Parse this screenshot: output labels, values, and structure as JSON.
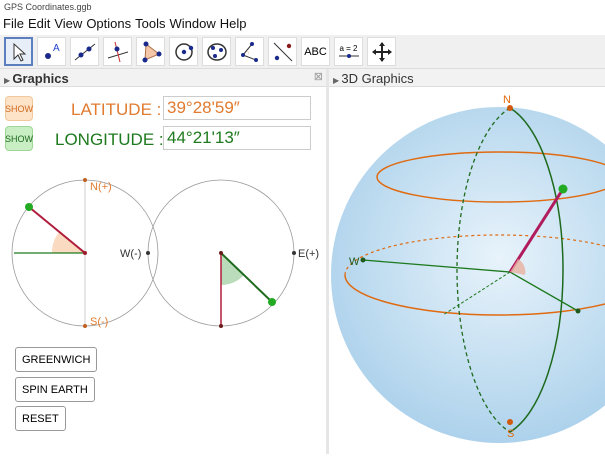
{
  "window": {
    "title": "GPS Coordinates.ggb"
  },
  "menu": [
    "File",
    "Edit",
    "View",
    "Options",
    "Tools",
    "Window",
    "Help"
  ],
  "toolbar": {
    "tools": [
      "move",
      "point",
      "line",
      "perpendicular-line",
      "polygon",
      "circle-center-point",
      "conic-five-points",
      "angle",
      "reflect",
      "text",
      "slider",
      "move-graphics-view"
    ],
    "text_tool_label": "ABC",
    "slider_label": "a = 2"
  },
  "panels": {
    "graphics": "Graphics",
    "graphics3d": "3D Graphics"
  },
  "latitude": {
    "show_label": "SHOW",
    "label": "LATITUDE :",
    "value": "39°28'59″",
    "color": "#e07b30"
  },
  "longitude": {
    "show_label": "SHOW",
    "label": "LONGITUDE :",
    "value": "44°21'13″",
    "color": "#1e7a1e"
  },
  "lat_dial": {
    "north": "N(+)",
    "south": "S(-)"
  },
  "lon_dial": {
    "west": "W(-)",
    "east": "E(+)"
  },
  "buttons": {
    "greenwich": "GREENWICH",
    "spin": "SPIN EARTH",
    "reset": "RESET"
  },
  "globe": {
    "north": "N",
    "south": "S",
    "west": "W"
  }
}
